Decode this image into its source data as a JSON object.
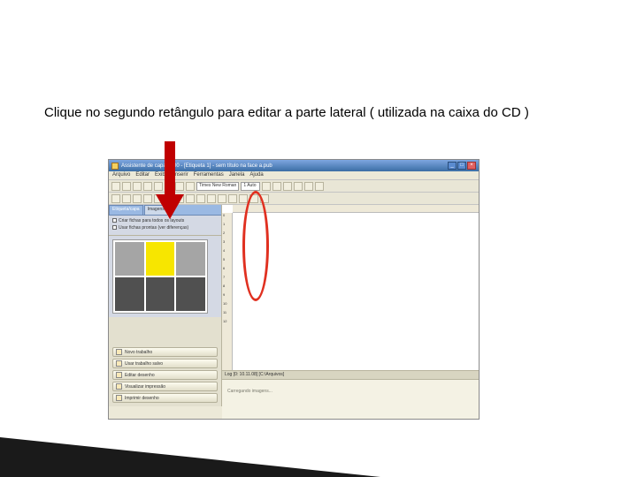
{
  "instruction_text": "Clique no segundo retângulo para editar a parte lateral ( utilizada na caixa do CD )",
  "app": {
    "title": "Assistente de capa 2000 - [Etiqueta 1] - sem título na face a.pub",
    "window_buttons": {
      "min": "_",
      "max": "□",
      "close": "×"
    },
    "menu": [
      "Arquivo",
      "Editar",
      "Exibir",
      "Inserir",
      "Ferramentas",
      "Janela",
      "Ajuda"
    ],
    "fontbox": "Times New Roman",
    "sizebox": "1 Auto"
  },
  "sidebar": {
    "tabs": [
      "Etiqueta/capa",
      "Imagens"
    ],
    "options": [
      "Criar fichas para todos os layouts",
      "Usar fichas prontas (ver diferenças)"
    ],
    "tasks": [
      "Novo trabalho",
      "Usar trabalho salvo",
      "Editar desenho",
      "Visualizar impressão",
      "Imprimir desenho"
    ]
  },
  "ruler_v": [
    "0",
    "1",
    "2",
    "3",
    "4",
    "5",
    "6",
    "7",
    "8",
    "9",
    "10",
    "11",
    "12"
  ],
  "log": {
    "header": "Log [0: 10.11.08] [C:\\Arquivos]",
    "message": "Carregando imagens..."
  },
  "annotations": {
    "arrow": "red-down-arrow",
    "ellipse": "red-ellipse"
  }
}
